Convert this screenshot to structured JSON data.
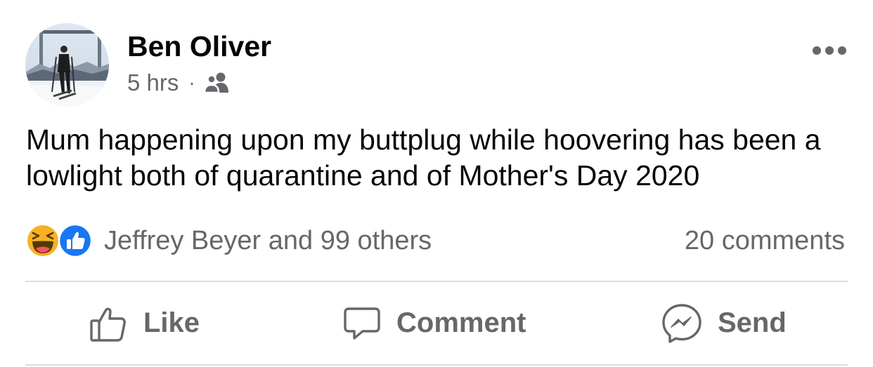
{
  "post": {
    "author": "Ben Oliver",
    "time": "5 hrs",
    "separator": "·",
    "audience_icon": "friends-icon",
    "text": "Mum happening upon my buttplug while hoovering has been a lowlight both of quarantine and of Mother's Day 2020"
  },
  "reactions": {
    "icons": [
      "haha-reaction-icon",
      "like-reaction-icon"
    ],
    "summary": "Jeffrey Beyer and 99 others",
    "comments": "20 comments"
  },
  "actions": {
    "like_label": "Like",
    "comment_label": "Comment",
    "send_label": "Send"
  },
  "colors": {
    "text_primary": "#050505",
    "text_secondary": "#65676b",
    "like_blue": "#1877f2",
    "haha_yellow": "#f7b125",
    "divider": "#dadde1"
  }
}
